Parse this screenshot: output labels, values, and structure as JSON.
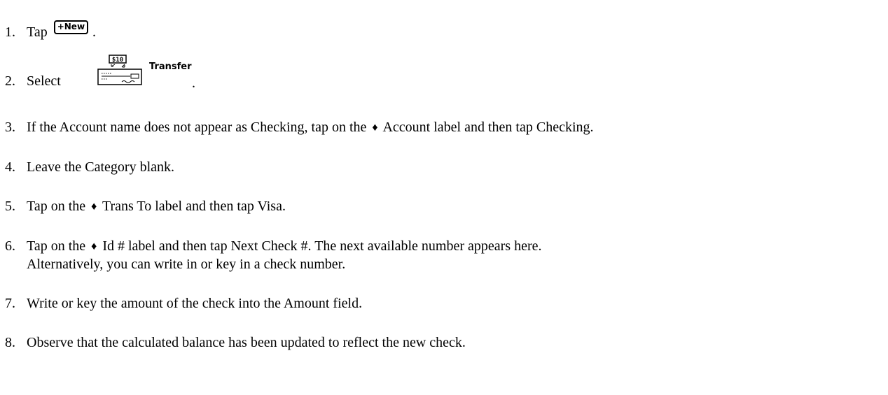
{
  "steps": [
    {
      "number": "1.",
      "before": "Tap",
      "button_label": "New",
      "after": "."
    },
    {
      "number": "2.",
      "before": "Select",
      "icon_top_text": "$10",
      "icon_label": "Transfer",
      "after": "."
    },
    {
      "number": "3.",
      "before": "If the Account name does not appear as Checking, tap on the",
      "diamond": "♦",
      "after": "Account label and then tap Checking."
    },
    {
      "number": "4.",
      "text": "Leave the Category blank."
    },
    {
      "number": "5.",
      "before": "Tap on the",
      "diamond": "♦",
      "after": "Trans To label and then tap Visa."
    },
    {
      "number": "6.",
      "before": "Tap on the",
      "diamond": "♦",
      "after": "Id # label and then tap Next Check #. The next available number appears here.",
      "line2": "Alternatively, you can write in or key in a check number."
    },
    {
      "number": "7.",
      "text": "Write or key the amount of the check into the Amount field."
    },
    {
      "number": "8.",
      "text": "Observe that the calculated balance has been updated to reflect the new check."
    }
  ]
}
